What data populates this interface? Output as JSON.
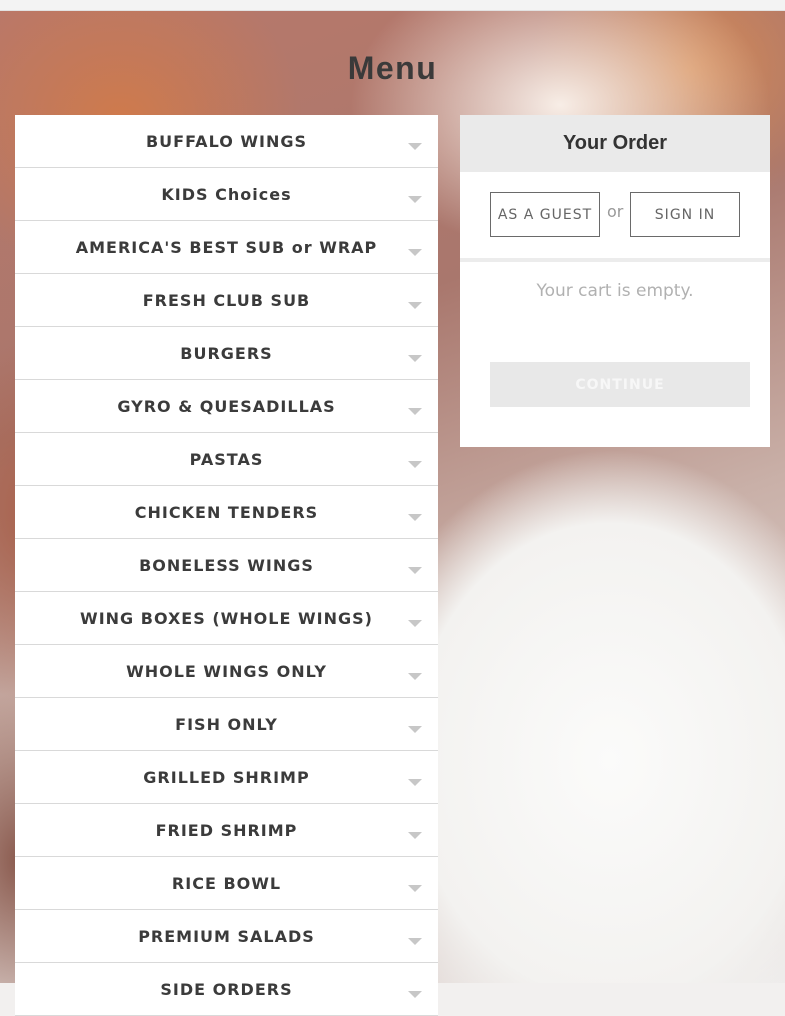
{
  "page": {
    "title": "Menu"
  },
  "menu": {
    "items": [
      {
        "label": "BUFFALO WINGS"
      },
      {
        "label": "KIDS Choices"
      },
      {
        "label": "AMERICA'S BEST SUB or WRAP"
      },
      {
        "label": "FRESH CLUB SUB"
      },
      {
        "label": "BURGERS"
      },
      {
        "label": "GYRO & QUESADILLAS"
      },
      {
        "label": "PASTAS"
      },
      {
        "label": "CHICKEN TENDERS"
      },
      {
        "label": "BONELESS WINGS"
      },
      {
        "label": "WING BOXES (WHOLE WINGS)"
      },
      {
        "label": "WHOLE WINGS ONLY"
      },
      {
        "label": "FISH ONLY"
      },
      {
        "label": "GRILLED SHRIMP"
      },
      {
        "label": "FRIED SHRIMP"
      },
      {
        "label": "RICE BOWL"
      },
      {
        "label": "PREMIUM SALADS"
      },
      {
        "label": "SIDE ORDERS"
      }
    ]
  },
  "order": {
    "title": "Your Order",
    "guest_label": "AS A GUEST",
    "or_label": "or",
    "signin_label": "SIGN IN",
    "empty_text": "Your cart is empty.",
    "continue_label": "CONTINUE"
  },
  "colors": {
    "text_dark": "#3b3b3b",
    "panel_header": "#eaeaea",
    "muted": "#b1b1b1",
    "continue_disabled": "#e8e8e8"
  }
}
